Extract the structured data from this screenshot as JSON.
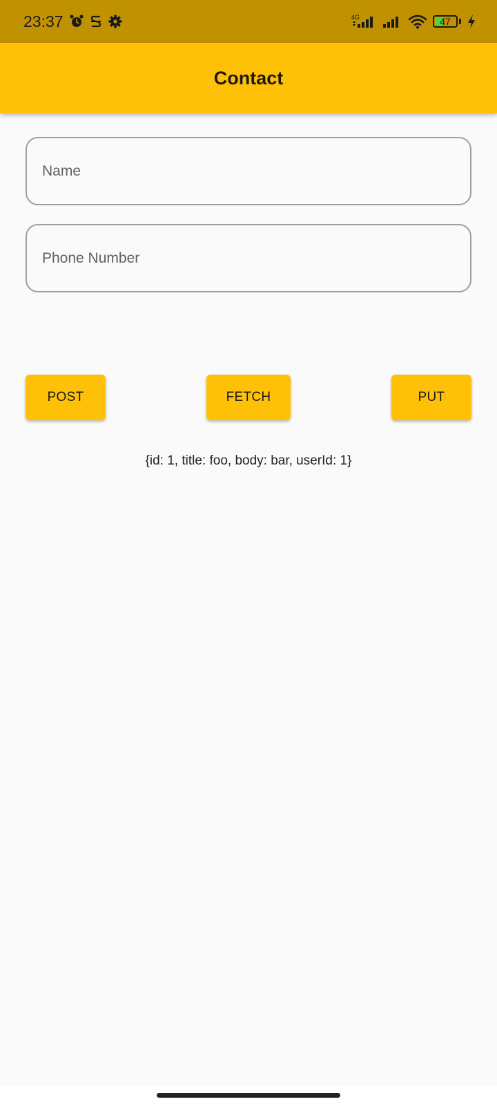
{
  "status_bar": {
    "time": "23:37",
    "network_type": "4G",
    "battery_level": "47",
    "battery_fraction": 0.47,
    "icons": [
      "alarm-icon",
      "app-notification-icon",
      "settings-gear-icon",
      "signal-4g-icon",
      "signal-icon",
      "wifi-icon",
      "battery-icon",
      "charging-bolt-icon"
    ],
    "background_color": "#C09100"
  },
  "app_bar": {
    "title": "Contact",
    "background_color": "#FFC107"
  },
  "form": {
    "name_placeholder": "Name",
    "name_value": "",
    "phone_placeholder": "Phone Number",
    "phone_value": ""
  },
  "actions": {
    "post_label": "POST",
    "fetch_label": "FETCH",
    "put_label": "PUT",
    "button_color": "#FFC107"
  },
  "response": {
    "text": "{id: 1, title: foo, body: bar, userId: 1}"
  }
}
